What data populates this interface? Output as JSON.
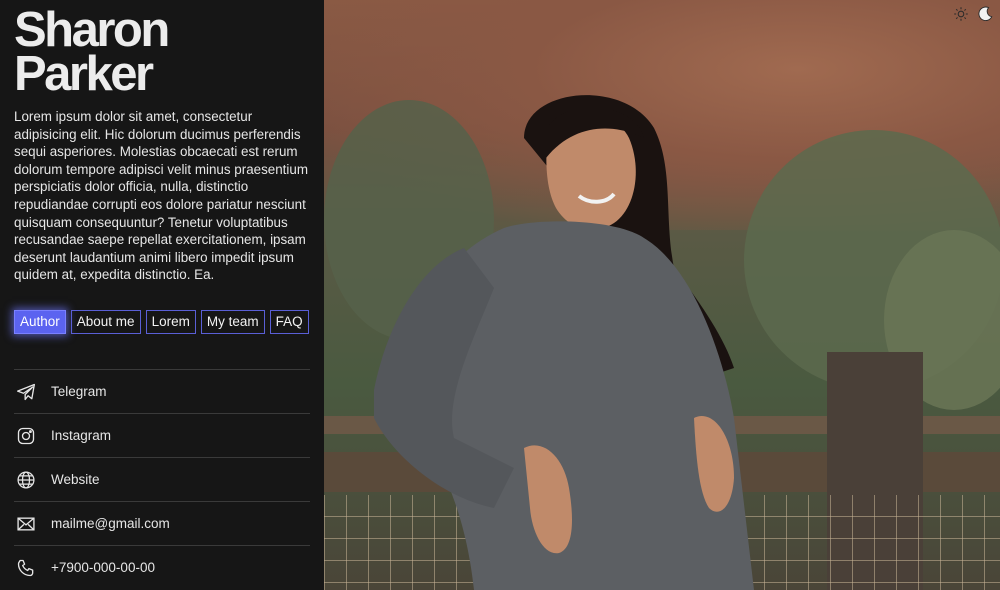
{
  "profile": {
    "first_name": "Sharon",
    "last_name": "Parker",
    "bio": "Lorem ipsum dolor sit amet, consectetur adipisicing elit. Hic dolorum ducimus perferendis sequi asperiores. Molestias obcaecati est rerum dolorum tempore adipisci velit minus praesentium perspiciatis dolor officia, nulla, distinctio repudiandae corrupti eos dolore pariatur nesciunt quisquam consequuntur? Tenetur voluptatibus recusandae saepe repellat exercitationem, ipsam deserunt laudantium animi libero impedit ipsum quidem at, expedita distinctio. Ea."
  },
  "tabs": [
    {
      "label": "Author",
      "active": true
    },
    {
      "label": "About me",
      "active": false
    },
    {
      "label": "Lorem",
      "active": false
    },
    {
      "label": "My team",
      "active": false
    },
    {
      "label": "FAQ",
      "active": false
    }
  ],
  "contacts": [
    {
      "label": "Telegram",
      "icon": "telegram-icon"
    },
    {
      "label": "Instagram",
      "icon": "instagram-icon"
    },
    {
      "label": "Website",
      "icon": "globe-icon"
    },
    {
      "label": "mailme@gmail.com",
      "icon": "mail-icon"
    },
    {
      "label": "+7900-000-00-00",
      "icon": "phone-icon"
    }
  ],
  "theme_toggle": {
    "icons": [
      "sun-icon",
      "moon-icon"
    ]
  },
  "colors": {
    "accent": "#5b63f0",
    "background": "#161616",
    "text": "#e8e8e8"
  }
}
